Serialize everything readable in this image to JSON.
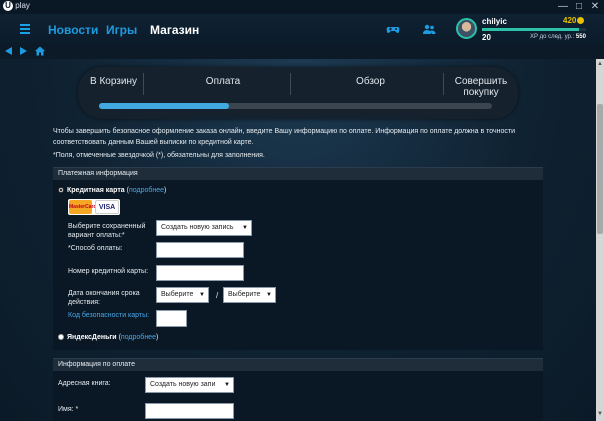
{
  "app": {
    "logo_text": "play",
    "logo_glyph": "U"
  },
  "window_controls": {
    "minimize": "—",
    "maximize": "□",
    "close": "✕"
  },
  "nav": {
    "items": [
      "Новости",
      "Игры",
      "Магазин"
    ],
    "active_index": 2
  },
  "profile": {
    "username": "chilyic",
    "coins": "420",
    "level": "20",
    "xp_label": "XP до след. ур.:",
    "xp_value": "550",
    "xp_progress": 0.93
  },
  "steps": {
    "items": [
      {
        "label": "В Корзину"
      },
      {
        "label": "Оплата"
      },
      {
        "label": "Обзор"
      },
      {
        "label": "Совершить покупку"
      }
    ],
    "progress": 0.33
  },
  "intro_text": "Чтобы завершить безопасное оформление заказа онлайн, введите Вашу информацию по оплате. Информация по оплате должна в точности соответствовать данным Вашей выписки по кредитной карте.",
  "required_note": "*Поля, отмеченные звездочкой (*), обязательны для заполнения.",
  "payment_section": {
    "title": "Платежная информация",
    "credit_card": {
      "label": "Кредитная карта",
      "more_link": "подробнее",
      "selected": true
    },
    "card_logos": [
      "MasterCard",
      "VISA"
    ],
    "saved_option_label": "Выберите сохраненный вариант оплаты:*",
    "saved_option_value": "Создать новую запись",
    "method_label": "*Способ оплаты:",
    "method_value": "",
    "card_number_label": "Номер кредитной карты:",
    "card_number_value": "",
    "expiry_label": "Дата окончания срока действия:",
    "expiry_month": "Выберите",
    "expiry_year": "Выберите",
    "expiry_separator": "/",
    "cvv_label": "Код безопасности карты:",
    "cvv_value": "",
    "yandex": {
      "label": "ЯндексДеньги",
      "more_link": "подробнее",
      "selected": false
    }
  },
  "billing_section": {
    "title": "Информация по оплате",
    "address_label": "Адресная книга:",
    "address_value": "Создать новую запи",
    "name_label": "Имя: *",
    "name_value": ""
  },
  "colors": {
    "accent": "#1d9be0",
    "link": "#4aa8e8",
    "progress": "#42a9e0",
    "xp": "#2bc2a9",
    "coins": "#e8c200"
  }
}
